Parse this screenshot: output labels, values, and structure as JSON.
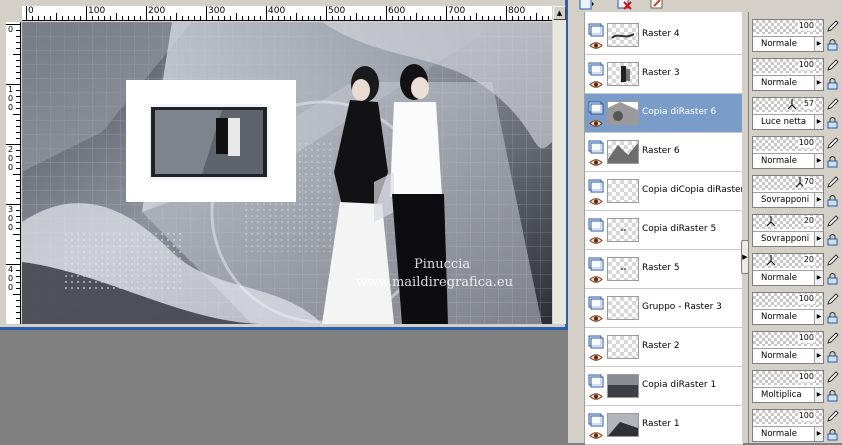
{
  "ruler": {
    "h_labels": [
      "0",
      "100",
      "200",
      "300",
      "400",
      "500",
      "600",
      "700",
      "800"
    ],
    "v_labels": [
      "0",
      "100",
      "200",
      "300",
      "400"
    ]
  },
  "canvas": {
    "watermark_line1": "Pinuccia",
    "watermark_line2": "www.maildiregrafica.eu"
  },
  "toolbar": {
    "icons": [
      "new-layer-icon",
      "delete-layer-icon",
      "link-icon"
    ]
  },
  "layers": [
    {
      "name": "Raster 4",
      "opacity": "100",
      "opacity_level": 100,
      "blend": "Normale",
      "selected": false,
      "thumb": "brush"
    },
    {
      "name": "Raster 3",
      "opacity": "100",
      "opacity_level": 100,
      "blend": "Normale",
      "selected": false,
      "thumb": "figure"
    },
    {
      "name": "Copia diRaster 6",
      "opacity": "57",
      "opacity_level": 57,
      "blend": "Luce netta",
      "selected": true,
      "thumb": "texture"
    },
    {
      "name": "Raster 6",
      "opacity": "100",
      "opacity_level": 100,
      "blend": "Normale",
      "selected": false,
      "thumb": "texture2"
    },
    {
      "name": "Copia diCopia diRaster",
      "opacity": "70",
      "opacity_level": 70,
      "blend": "Sovrapponi",
      "selected": false,
      "thumb": "empty"
    },
    {
      "name": "Copia diRaster 5",
      "opacity": "20",
      "opacity_level": 20,
      "blend": "Sovrapponi",
      "selected": false,
      "thumb": "dots"
    },
    {
      "name": "Raster 5",
      "opacity": "20",
      "opacity_level": 20,
      "blend": "Normale",
      "selected": false,
      "thumb": "dots"
    },
    {
      "name": "Gruppo - Raster 3",
      "opacity": "100",
      "opacity_level": 100,
      "blend": "Normale",
      "selected": false,
      "thumb": "empty"
    },
    {
      "name": "Raster 2",
      "opacity": "100",
      "opacity_level": 100,
      "blend": "Normale",
      "selected": false,
      "thumb": "empty"
    },
    {
      "name": "Copia diRaster 1",
      "opacity": "100",
      "opacity_level": 100,
      "blend": "Moltiplica",
      "selected": false,
      "thumb": "dark"
    },
    {
      "name": "Raster 1",
      "opacity": "100",
      "opacity_level": 100,
      "blend": "Normale",
      "selected": false,
      "thumb": "dark2"
    }
  ],
  "colors": {
    "selection": "#7a9cc8",
    "window_border": "#2a5fb0",
    "workspace": "#808080"
  }
}
